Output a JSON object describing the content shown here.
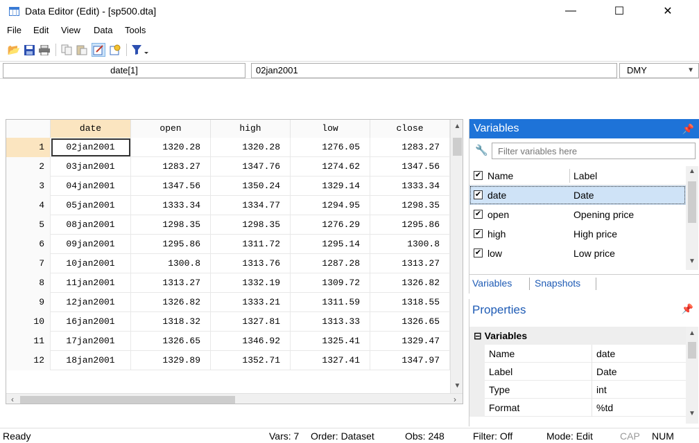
{
  "window": {
    "title": "Data Editor (Edit) - [sp500.dta]",
    "minimize_glyph": "—",
    "maximize_glyph": "☐",
    "close_glyph": "✕"
  },
  "menu": [
    "File",
    "Edit",
    "View",
    "Data",
    "Tools"
  ],
  "toolbar_icons": [
    "open-icon",
    "save-icon",
    "print-icon",
    "copy-icon",
    "paste-icon",
    "edit-mode-icon",
    "browse-mode-icon",
    "filter-icon"
  ],
  "editbar": {
    "cell_ref": "date[1]",
    "cell_value": "02jan2001",
    "format": "DMY"
  },
  "grid": {
    "columns": [
      "date",
      "open",
      "high",
      "low",
      "close"
    ],
    "rows": [
      {
        "n": "1",
        "date": "02jan2001",
        "open": "1320.28",
        "high": "1320.28",
        "low": "1276.05",
        "close": "1283.27"
      },
      {
        "n": "2",
        "date": "03jan2001",
        "open": "1283.27",
        "high": "1347.76",
        "low": "1274.62",
        "close": "1347.56"
      },
      {
        "n": "3",
        "date": "04jan2001",
        "open": "1347.56",
        "high": "1350.24",
        "low": "1329.14",
        "close": "1333.34"
      },
      {
        "n": "4",
        "date": "05jan2001",
        "open": "1333.34",
        "high": "1334.77",
        "low": "1294.95",
        "close": "1298.35"
      },
      {
        "n": "5",
        "date": "08jan2001",
        "open": "1298.35",
        "high": "1298.35",
        "low": "1276.29",
        "close": "1295.86"
      },
      {
        "n": "6",
        "date": "09jan2001",
        "open": "1295.86",
        "high": "1311.72",
        "low": "1295.14",
        "close": "1300.8"
      },
      {
        "n": "7",
        "date": "10jan2001",
        "open": "1300.8",
        "high": "1313.76",
        "low": "1287.28",
        "close": "1313.27"
      },
      {
        "n": "8",
        "date": "11jan2001",
        "open": "1313.27",
        "high": "1332.19",
        "low": "1309.72",
        "close": "1326.82"
      },
      {
        "n": "9",
        "date": "12jan2001",
        "open": "1326.82",
        "high": "1333.21",
        "low": "1311.59",
        "close": "1318.55"
      },
      {
        "n": "10",
        "date": "16jan2001",
        "open": "1318.32",
        "high": "1327.81",
        "low": "1313.33",
        "close": "1326.65"
      },
      {
        "n": "11",
        "date": "17jan2001",
        "open": "1326.65",
        "high": "1346.92",
        "low": "1325.41",
        "close": "1329.47"
      },
      {
        "n": "12",
        "date": "18jan2001",
        "open": "1329.89",
        "high": "1352.71",
        "low": "1327.41",
        "close": "1347.97"
      }
    ]
  },
  "variables": {
    "title": "Variables",
    "filter_placeholder": "Filter variables here",
    "col_name": "Name",
    "col_label": "Label",
    "items": [
      {
        "name": "date",
        "label": "Date"
      },
      {
        "name": "open",
        "label": "Opening price"
      },
      {
        "name": "high",
        "label": "High price"
      },
      {
        "name": "low",
        "label": "Low price"
      }
    ],
    "tabs": [
      "Variables",
      "Snapshots"
    ]
  },
  "properties": {
    "title": "Properties",
    "group": "Variables",
    "items": [
      {
        "key": "Name",
        "value": "date"
      },
      {
        "key": "Label",
        "value": "Date"
      },
      {
        "key": "Type",
        "value": "int"
      },
      {
        "key": "Format",
        "value": "%td"
      }
    ]
  },
  "status": {
    "ready": "Ready",
    "vars": "Vars: 7",
    "order": "Order: Dataset",
    "obs": "Obs: 248",
    "filter": "Filter: Off",
    "mode": "Mode: Edit",
    "cap": "CAP",
    "num": "NUM"
  }
}
